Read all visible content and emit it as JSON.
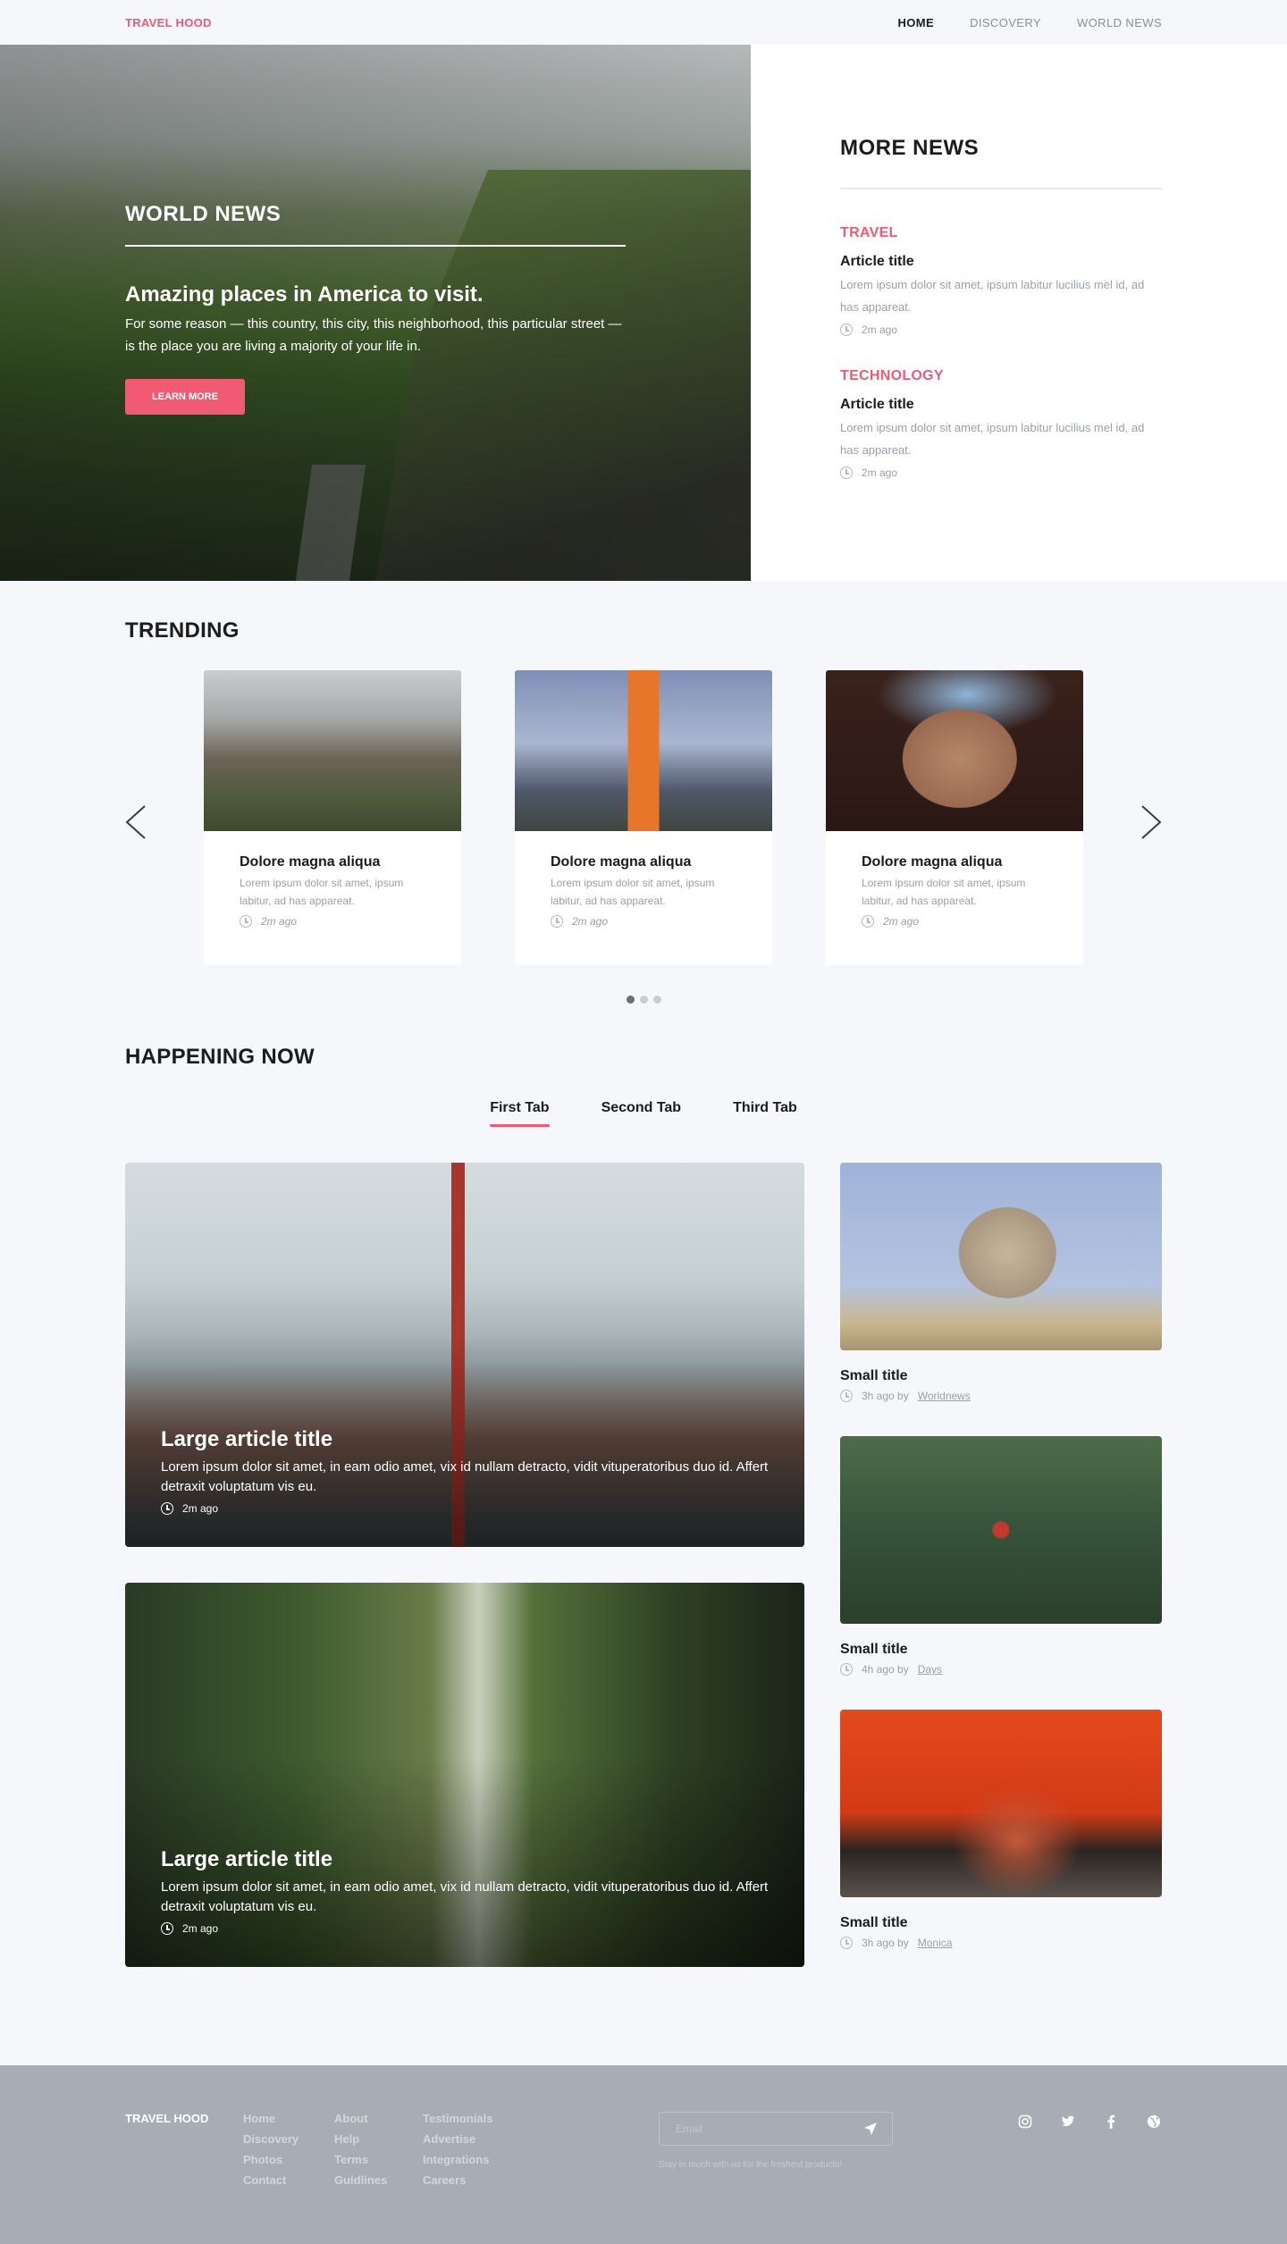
{
  "header": {
    "logo": "TRAVEL HOOD",
    "nav": [
      "HOME",
      "DISCOVERY",
      "WORLD NEWS"
    ]
  },
  "hero": {
    "kicker": "WORLD NEWS",
    "title": "Amazing places in America to visit.",
    "description": "For some reason — this country, this city, this neighborhood, this particular street — is the place you are living a majority of your life in.",
    "button": "LEARN MORE"
  },
  "more_news": {
    "title": "MORE NEWS",
    "items": [
      {
        "category": "TRAVEL",
        "title": "Article title",
        "text": "Lorem ipsum dolor sit amet, ipsum labitur lucilius mel id, ad has appareat.",
        "time": "2m ago"
      },
      {
        "category": "TECHNOLOGY",
        "title": "Article title",
        "text": "Lorem ipsum dolor sit amet, ipsum labitur lucilius mel id, ad has appareat.",
        "time": "2m ago"
      }
    ]
  },
  "trending": {
    "title": "TRENDING",
    "cards": [
      {
        "title": "Dolore magna aliqua",
        "text": "Lorem ipsum dolor sit amet, ipsum labitur, ad has appareat.",
        "time": "2m ago"
      },
      {
        "title": "Dolore magna aliqua",
        "text": "Lorem ipsum dolor sit amet, ipsum labitur, ad has appareat.",
        "time": "2m ago"
      },
      {
        "title": "Dolore magna aliqua",
        "text": "Lorem ipsum dolor sit amet, ipsum labitur, ad has appareat.",
        "time": "2m ago"
      }
    ]
  },
  "happening": {
    "title": "HAPPENING NOW",
    "tabs": [
      "First Tab",
      "Second Tab",
      "Third Tab"
    ],
    "large": [
      {
        "title": "Large article title",
        "text": "Lorem ipsum dolor sit amet, in eam odio amet, vix id nullam detracto, vidit vituperatoribus duo id. Affert detraxit voluptatum vis eu.",
        "time": "2m ago"
      },
      {
        "title": "Large article title",
        "text": "Lorem ipsum dolor sit amet, in eam odio amet, vix id nullam detracto, vidit vituperatoribus duo id. Affert detraxit voluptatum vis eu.",
        "time": "2m ago"
      }
    ],
    "small": [
      {
        "title": "Small title",
        "time": "3h ago by",
        "author": "Worldnews"
      },
      {
        "title": "Small title",
        "time": "4h ago by",
        "author": "Days"
      },
      {
        "title": "Small title",
        "time": "3h ago by",
        "author": "Monica"
      }
    ]
  },
  "footer": {
    "logo": "TRAVEL HOOD",
    "col1": [
      "Home",
      "Discovery",
      "Photos",
      "Contact"
    ],
    "col2": [
      "About",
      "Help",
      "Terms",
      "Guidlines"
    ],
    "col3": [
      "Testimonials",
      "Advertise",
      "Integrations",
      "Careers"
    ],
    "email_placeholder": "Email",
    "note": "Stay in touch with us for the freshest products!",
    "social_icons": [
      "instagram-icon",
      "twitter-icon",
      "facebook-icon",
      "globe-icon"
    ]
  },
  "colors": {
    "accent": "#f05a72",
    "footer_bg": "#a7adb4"
  }
}
